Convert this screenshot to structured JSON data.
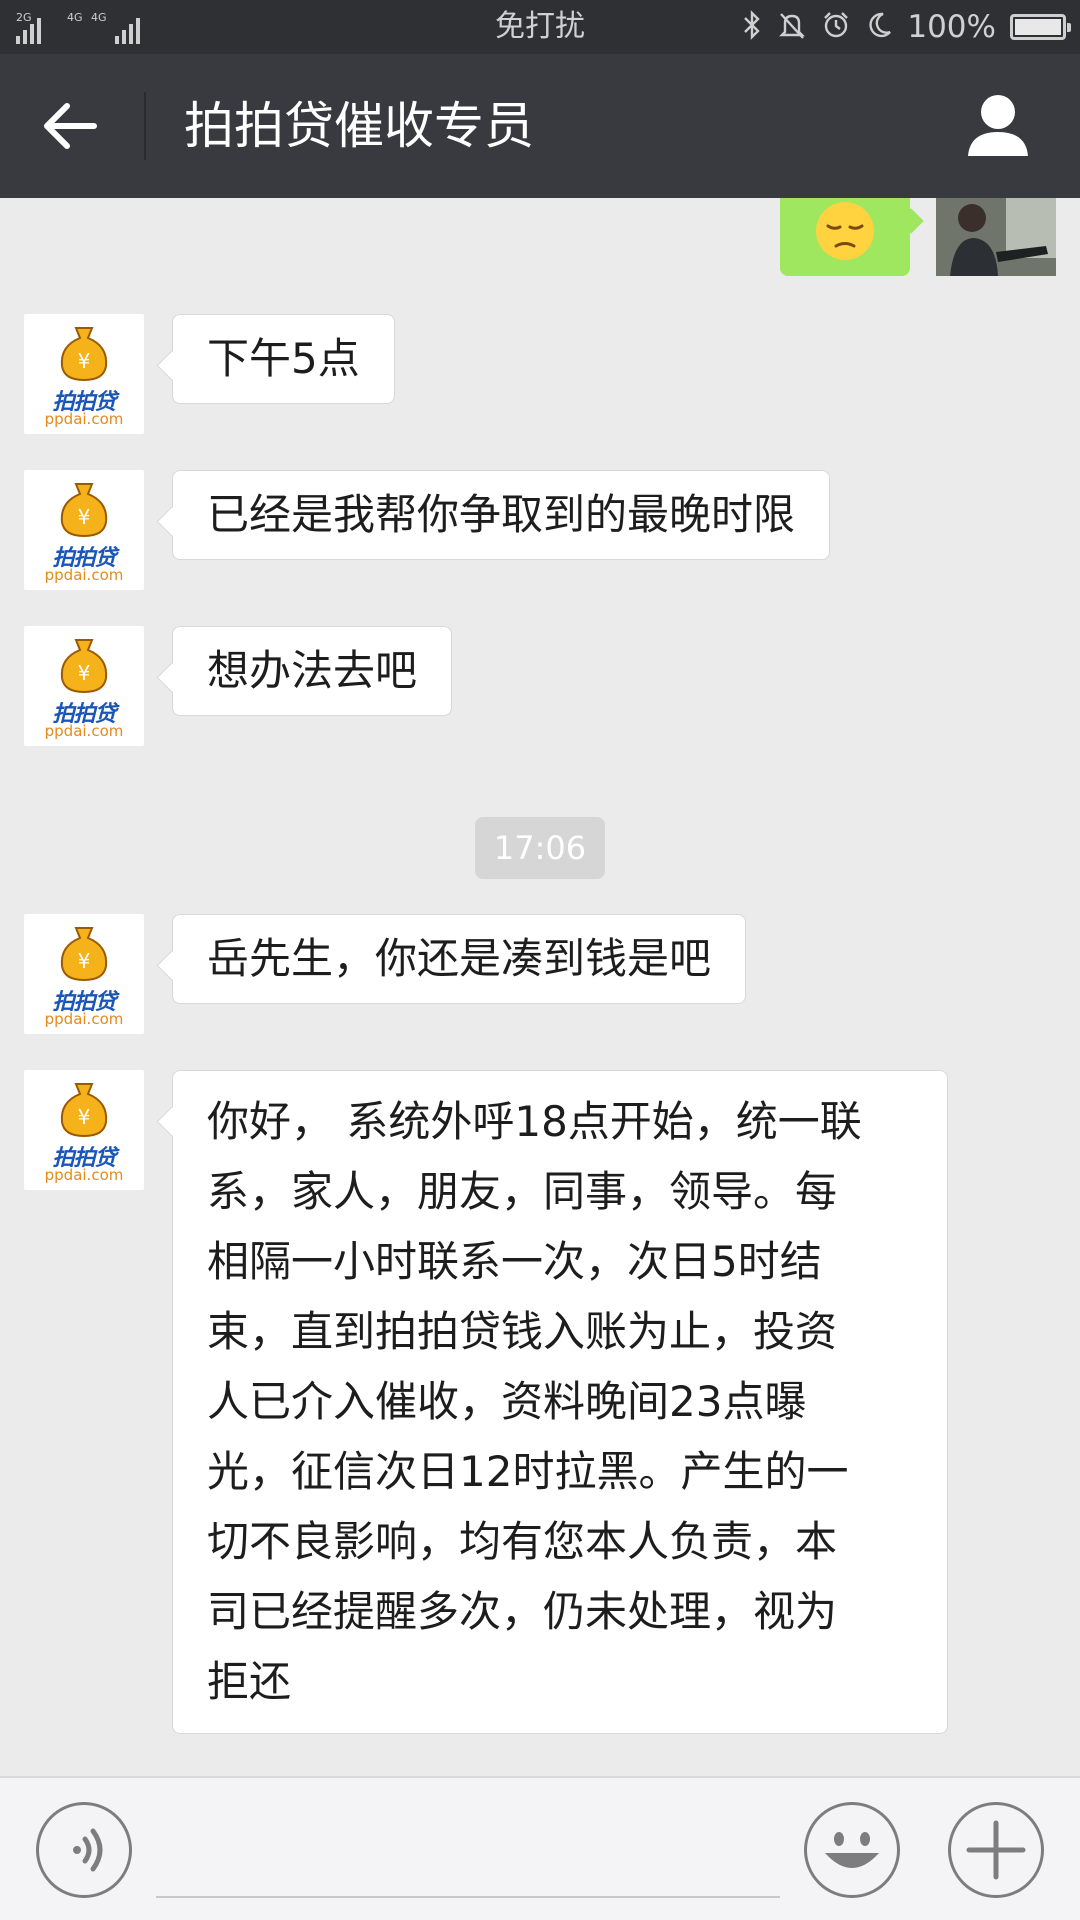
{
  "status_bar": {
    "signal1_label": "2G",
    "signal2_label": "4G",
    "signal3_label": "4G",
    "center_text": "免打扰",
    "battery_percent": "100%",
    "battery_level": 1.0,
    "icons": [
      "bluetooth-icon",
      "mute-bell-icon",
      "alarm-icon",
      "moon-icon"
    ]
  },
  "header": {
    "title": "拍拍贷催收专员",
    "back_icon": "arrow-left-icon",
    "profile_icon": "person-icon"
  },
  "contact_avatar": {
    "brand": "拍拍贷",
    "domain": "ppdai.com"
  },
  "messages": [
    {
      "sender": "self",
      "type": "emoji",
      "emoji": "pensive-face"
    },
    {
      "sender": "contact",
      "text": "下午5点"
    },
    {
      "sender": "contact",
      "text": "已经是我帮你争取到的最晚时限"
    },
    {
      "sender": "contact",
      "text": "想办法去吧"
    },
    {
      "sender": "contact",
      "text": "岳先生，你还是凑到钱是吧"
    },
    {
      "sender": "contact",
      "lines": [
        "你好， 系统外呼18点开始，统一联",
        "系，家人，朋友，同事，领导。每",
        "相隔一小时联系一次，次日5时结",
        "束，直到拍拍贷钱入账为止，投资",
        "人已介入催收，资料晚间23点曝",
        "光，征信次日12时拉黑。产生的一",
        "切不良影响，均有您本人负责，本",
        "司已经提醒多次，仍未处理，视为",
        "拒还"
      ]
    }
  ],
  "timestamp": "17:06",
  "input_bar": {
    "voice_icon": "voice-icon",
    "emoji_icon": "smiley-icon",
    "plus_icon": "plus-icon"
  }
}
